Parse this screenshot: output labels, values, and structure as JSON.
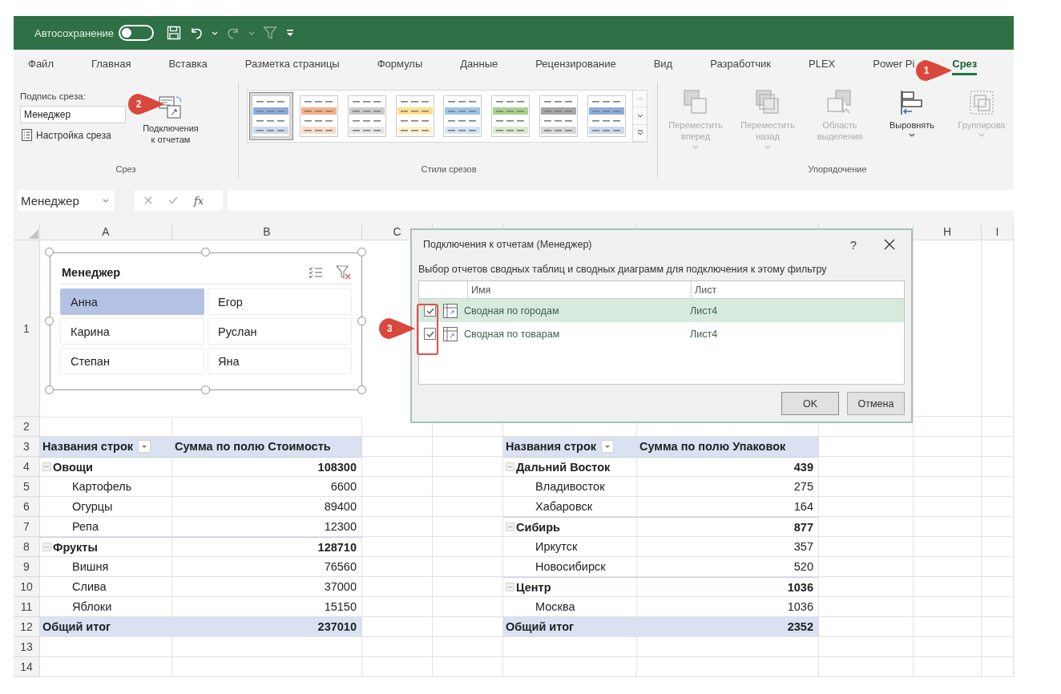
{
  "title_bar": {
    "autosave_label": "Автосохранение",
    "autosave_on": false
  },
  "tabs": [
    {
      "label": "Файл",
      "selected": false
    },
    {
      "label": "Главная",
      "selected": false
    },
    {
      "label": "Вставка",
      "selected": false
    },
    {
      "label": "Разметка страницы",
      "selected": false
    },
    {
      "label": "Формулы",
      "selected": false
    },
    {
      "label": "Данные",
      "selected": false
    },
    {
      "label": "Рецензирование",
      "selected": false
    },
    {
      "label": "Вид",
      "selected": false
    },
    {
      "label": "Разработчик",
      "selected": false
    },
    {
      "label": "PLEX",
      "selected": false
    },
    {
      "label": "Power Pi",
      "selected": false
    },
    {
      "label": "Срез",
      "selected": true
    }
  ],
  "ribbon": {
    "groups": [
      {
        "kind": "slicer",
        "label": "Срез",
        "caption_label": "Подпись среза:",
        "caption_value": "Менеджер",
        "settings_button": "Настройка среза",
        "connections_button": "Подключения к отчетам"
      },
      {
        "kind": "styles",
        "label": "Стили срезов",
        "styles": [
          {
            "color": "#8eaadb",
            "selected": true
          },
          {
            "color": "#f4b183",
            "selected": false
          },
          {
            "color": "#c9c9c9",
            "selected": false
          },
          {
            "color": "#ffe08a",
            "selected": false
          },
          {
            "color": "#9dc3e6",
            "selected": false
          },
          {
            "color": "#a9d18e",
            "selected": false
          },
          {
            "color": "#a6a6a6",
            "selected": false
          },
          {
            "color": "#8faadc",
            "selected": false
          }
        ]
      },
      {
        "kind": "arrange",
        "label": "Упорядочение",
        "buttons": [
          {
            "kind": "forward",
            "label": "Переместить вперед",
            "disabled": true,
            "has_menu": true
          },
          {
            "kind": "backward",
            "label": "Переместить назад",
            "disabled": true,
            "has_menu": true
          },
          {
            "kind": "selection",
            "label": "Область выделения",
            "disabled": true,
            "has_menu": false
          },
          {
            "kind": "align",
            "label": "Выровнять",
            "disabled": false,
            "has_menu": true
          },
          {
            "kind": "group",
            "label": "Группирова",
            "disabled": true,
            "has_menu": true
          }
        ]
      }
    ]
  },
  "formula_bar": {
    "name_box": "Менеджер",
    "function_button": "fx"
  },
  "sheet": {
    "column_headers": [
      "A",
      "B",
      "C",
      "H",
      "I"
    ],
    "row_numbers": [
      "1",
      "2",
      "3",
      "4",
      "5",
      "6",
      "7",
      "8",
      "9",
      "10",
      "11",
      "12",
      "13",
      "14"
    ],
    "pivot_tables": [
      {
        "row_labels_header": "Названия строк",
        "values_header": "Сумма по полю Стоимость",
        "rows": [
          {
            "kind": "group",
            "label": "Овощи",
            "value": "108300",
            "expanded": true
          },
          {
            "kind": "item",
            "label": "Картофель",
            "value": "6600"
          },
          {
            "kind": "item",
            "label": "Огурцы",
            "value": "89400"
          },
          {
            "kind": "item",
            "label": "Репа",
            "value": "12300"
          },
          {
            "kind": "group",
            "label": "Фрукты",
            "value": "128710",
            "expanded": true
          },
          {
            "kind": "item",
            "label": "Вишня",
            "value": "76560"
          },
          {
            "kind": "item",
            "label": "Слива",
            "value": "37000"
          },
          {
            "kind": "item",
            "label": "Яблоки",
            "value": "15150"
          },
          {
            "kind": "total",
            "label": "Общий итог",
            "value": "237010"
          }
        ]
      },
      {
        "row_labels_header": "Названия строк",
        "values_header": "Сумма по полю Упаковок",
        "rows": [
          {
            "kind": "group",
            "label": "Дальний Восток",
            "value": "439",
            "expanded": true
          },
          {
            "kind": "item",
            "label": "Владивосток",
            "value": "275"
          },
          {
            "kind": "item",
            "label": "Хабаровск",
            "value": "164"
          },
          {
            "kind": "group",
            "label": "Сибирь",
            "value": "877",
            "expanded": true
          },
          {
            "kind": "item",
            "label": "Иркутск",
            "value": "357"
          },
          {
            "kind": "item",
            "label": "Новосибирск",
            "value": "520"
          },
          {
            "kind": "group",
            "label": "Центр",
            "value": "1036",
            "expanded": true
          },
          {
            "kind": "item",
            "label": "Москва",
            "value": "1036"
          },
          {
            "kind": "total",
            "label": "Общий итог",
            "value": "2352"
          }
        ]
      }
    ]
  },
  "slicer": {
    "title": "Менеджер",
    "items": [
      {
        "label": "Анна",
        "selected": true
      },
      {
        "label": "Егор",
        "selected": false
      },
      {
        "label": "Карина",
        "selected": false
      },
      {
        "label": "Руслан",
        "selected": false
      },
      {
        "label": "Степан",
        "selected": false
      },
      {
        "label": "Яна",
        "selected": false
      }
    ]
  },
  "dialog": {
    "title": "Подключения к отчетам (Менеджер)",
    "help": "?",
    "description": "Выбор отчетов сводных таблиц и сводных диаграмм для подключения к этому фильтру",
    "columns": [
      "Имя",
      "Лист"
    ],
    "rows": [
      {
        "name": "Сводная по городам",
        "sheet": "Лист4",
        "checked": true,
        "selected": true
      },
      {
        "name": "Сводная по товарам",
        "sheet": "Лист4",
        "checked": true,
        "selected": false
      }
    ],
    "buttons": [
      {
        "label": "OK",
        "kind": "default"
      },
      {
        "label": "Отмена",
        "kind": "cancel"
      }
    ]
  },
  "callouts": [
    {
      "number": "1"
    },
    {
      "number": "2"
    },
    {
      "number": "3"
    }
  ]
}
